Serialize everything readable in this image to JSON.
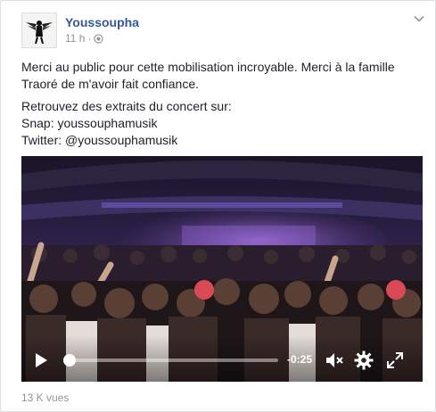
{
  "post": {
    "author": "Youssoupha",
    "timestamp": "11 h",
    "separator": "·",
    "privacy_icon": "globe-icon",
    "menu_icon": "chevron-down-icon",
    "paragraphs": [
      [
        "Merci au public pour cette mobilisation incroyable. Merci à la famille",
        "Traoré de m'avoir fait confiance."
      ],
      [
        "Retrouvez des extraits du concert sur:",
        "Snap: youssouphamusik",
        "Twitter: @youssouphamusik"
      ]
    ]
  },
  "video": {
    "time_remaining": "-0:25",
    "progress": 0.0,
    "icons": [
      "play-icon",
      "mute-icon",
      "settings-icon",
      "fullscreen-icon"
    ]
  },
  "footer": {
    "views": "13 K vues"
  },
  "colors": {
    "author": "#365899",
    "meta": "#90949c",
    "text": "#1d2129"
  }
}
